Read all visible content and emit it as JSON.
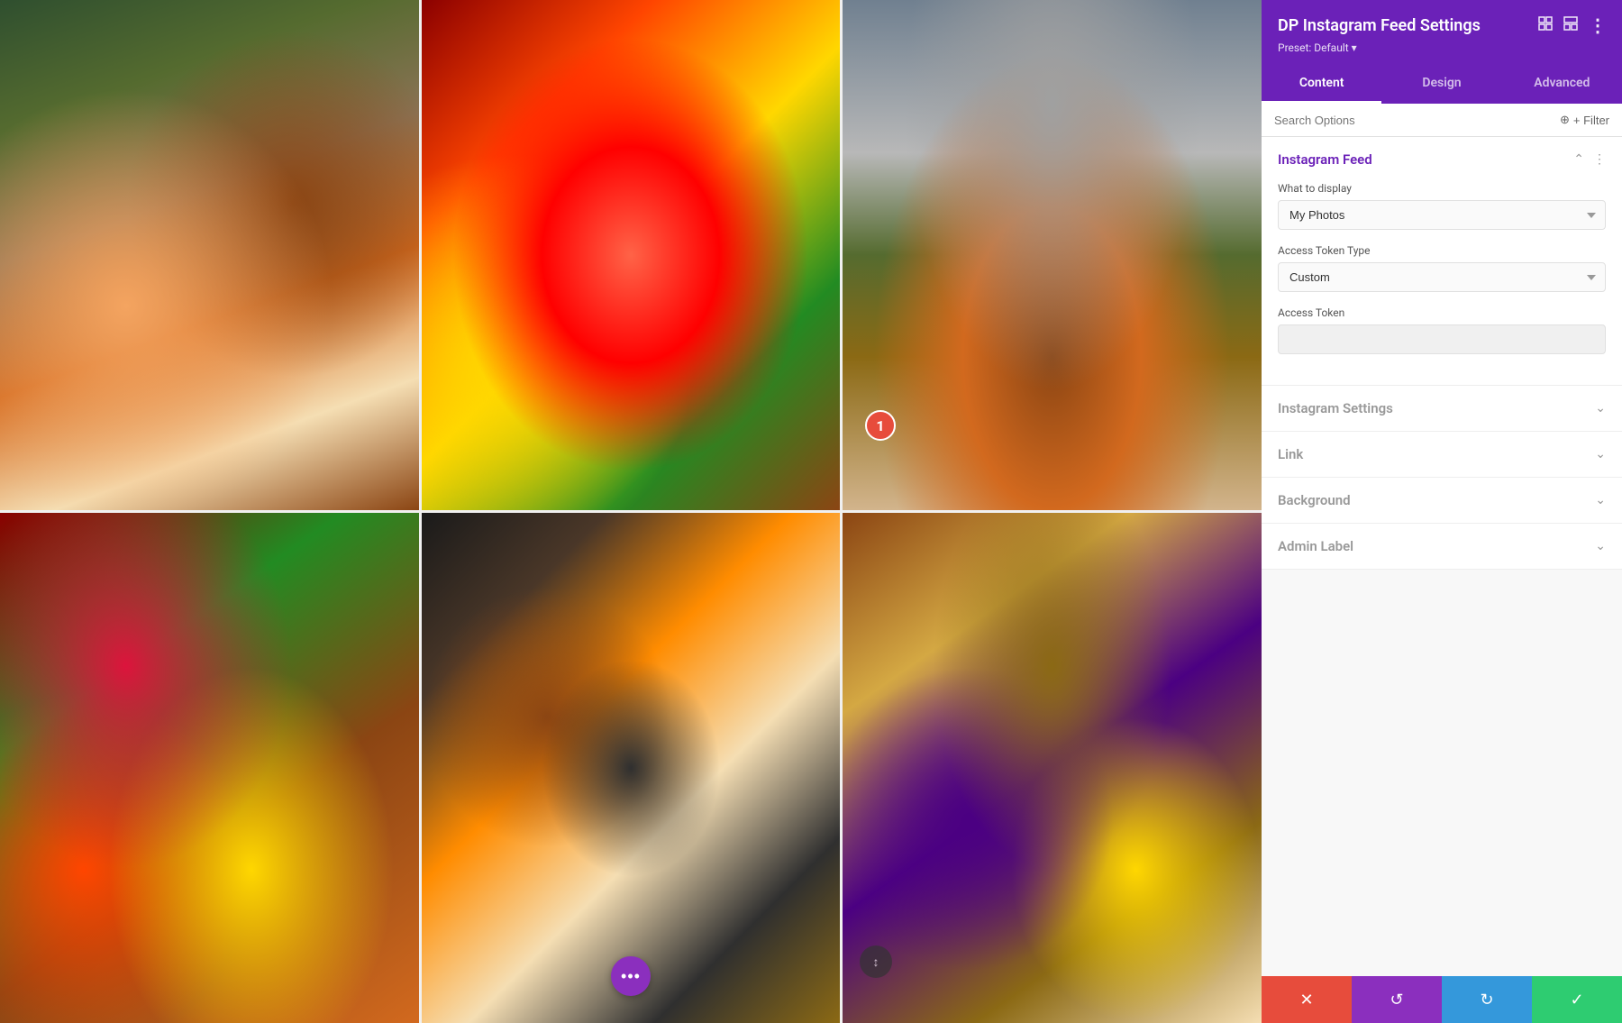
{
  "panel": {
    "title": "DP Instagram Feed Settings",
    "preset": "Preset: Default ▾",
    "tabs": [
      {
        "label": "Content",
        "active": true
      },
      {
        "label": "Design",
        "active": false
      },
      {
        "label": "Advanced",
        "active": false
      }
    ],
    "search": {
      "placeholder": "Search Options",
      "filter_label": "+ Filter"
    },
    "sections": {
      "instagram_feed": {
        "title": "Instagram Feed",
        "what_to_display_label": "What to display",
        "what_to_display_value": "My Photos",
        "access_token_type_label": "Access Token Type",
        "access_token_type_value": "Custom",
        "access_token_label": "Access Token",
        "access_token_value": ""
      },
      "instagram_settings": {
        "title": "Instagram Settings"
      },
      "link": {
        "title": "Link"
      },
      "background": {
        "title": "Background"
      },
      "admin_label": {
        "title": "Admin Label"
      }
    }
  },
  "actions": {
    "cancel_label": "✕",
    "undo_label": "↺",
    "redo_label": "↻",
    "save_label": "✓"
  },
  "step_indicator": "1",
  "dots_btn_label": "•••",
  "scroll_icon": "↕"
}
